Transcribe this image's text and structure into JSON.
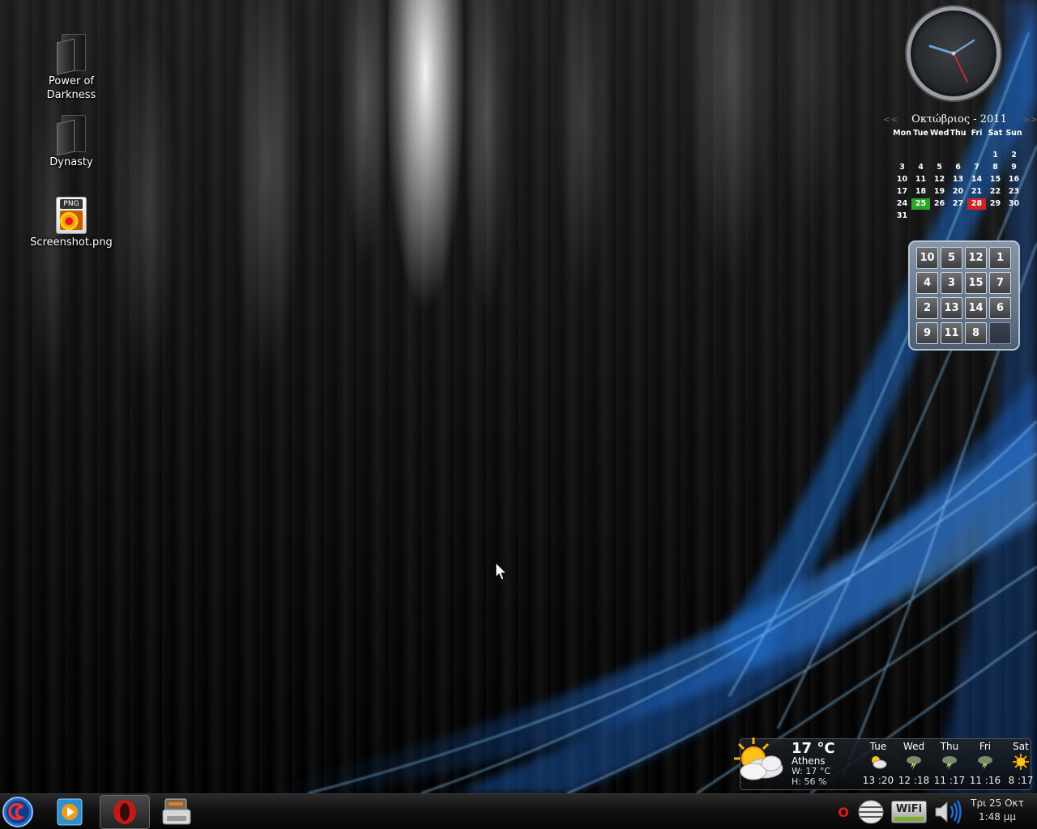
{
  "desktop": {
    "icons": [
      {
        "label_line1": "Power of",
        "label_line2": "Darkness",
        "icon": "folder-icon"
      },
      {
        "label_line1": "Dynasty",
        "icon": "folder-icon"
      },
      {
        "label_line1": "Screenshot.png",
        "icon": "png-file-icon",
        "badge": "PNG"
      }
    ]
  },
  "calendar": {
    "prev": "<<",
    "next": ">>",
    "title": "Οκτώβριος - 2011",
    "weekdays": [
      "Mon",
      "Tue",
      "Wed",
      "Thu",
      "Fri",
      "Sat",
      "Sun"
    ],
    "weeks": [
      [
        "",
        "",
        "",
        "",
        "",
        "1",
        "2"
      ],
      [
        "3",
        "4",
        "5",
        "6",
        "7",
        "8",
        "9"
      ],
      [
        "10",
        "11",
        "12",
        "13",
        "14",
        "15",
        "16"
      ],
      [
        "17",
        "18",
        "19",
        "20",
        "21",
        "22",
        "23"
      ],
      [
        "24",
        "25",
        "26",
        "27",
        "28",
        "29",
        "30"
      ],
      [
        "31",
        "",
        "",
        "",
        "",
        "",
        ""
      ]
    ],
    "today": "25",
    "marked": "28",
    "today_color": "#2aa52a",
    "marked_color": "#d22121"
  },
  "clock": {
    "time": "1:48"
  },
  "puzzle": {
    "tiles": [
      "10",
      "5",
      "12",
      "1",
      "4",
      "3",
      "15",
      "7",
      "2",
      "13",
      "14",
      "6",
      "9",
      "11",
      "8",
      ""
    ]
  },
  "weather": {
    "temp": "17 °C",
    "city": "Athens",
    "wind": "W: 17 °C",
    "humidity": "H: 56 %",
    "current_icon": "partly-cloudy-sun-icon",
    "forecast": [
      {
        "day": "Tue",
        "icon": "partly-cloudy-sun-icon",
        "temps": "13 :20"
      },
      {
        "day": "Wed",
        "icon": "thunderstorm-icon",
        "temps": "12 :18"
      },
      {
        "day": "Thu",
        "icon": "thunderstorm-icon",
        "temps": "11 :17"
      },
      {
        "day": "Fri",
        "icon": "thunderstorm-icon",
        "temps": "11 :16"
      },
      {
        "day": "Sat",
        "icon": "sun-icon",
        "temps": "8 :17"
      }
    ]
  },
  "taskbar": {
    "launchers": [
      {
        "name": "debian-menu-icon"
      },
      {
        "name": "media-player-icon"
      },
      {
        "name": "opera-icon",
        "active": true
      },
      {
        "name": "file-manager-icon"
      }
    ],
    "tray": [
      "opera-tray-icon",
      "network-manager-icon",
      "wifi-icon",
      "volume-icon"
    ],
    "wifi_label": "WiFi",
    "opera_letter": "O",
    "clock_date": "Τρι 25 Οκτ",
    "clock_time": "1:48 μμ"
  },
  "colors": {
    "accent_blue": "#1e6fd9",
    "tile_border": "#cfd4d9"
  }
}
